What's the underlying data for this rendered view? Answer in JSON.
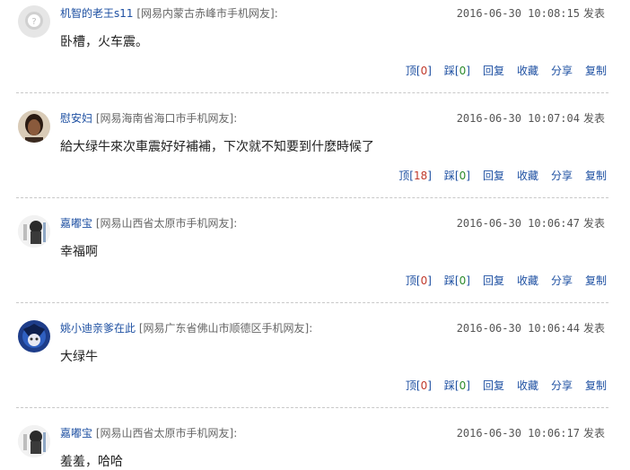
{
  "actions": {
    "up": "顶",
    "down": "踩",
    "reply": "回复",
    "favorite": "收藏",
    "share": "分享",
    "copy": "复制",
    "publish": "发表"
  },
  "comments": [
    {
      "username": "机智的老王s11",
      "location": "[网易内蒙古赤峰市手机网友]:",
      "time": "2016-06-30 10:08:15",
      "content": "卧槽，火车震。",
      "up": "0",
      "down": "0",
      "avatar": "default-avatar-icon"
    },
    {
      "username": "慰安妇",
      "location": "[网易海南省海口市手机网友]:",
      "time": "2016-06-30 10:07:04",
      "content": "給大绿牛來次車震好好補補，下次就不知要到什麽時候了",
      "up": "18",
      "down": "0",
      "avatar": "photo-avatar"
    },
    {
      "username": "嘉嘟宝",
      "location": "[网易山西省太原市手机网友]:",
      "time": "2016-06-30 10:06:47",
      "content": "幸福啊",
      "up": "0",
      "down": "0",
      "avatar": "illustrated-avatar"
    },
    {
      "username": "姚小迪亲爹在此",
      "location": "[网易广东省佛山市顺德区手机网友]:",
      "time": "2016-06-30 10:06:44",
      "content": "大绿牛",
      "up": "0",
      "down": "0",
      "avatar": "anime-avatar"
    },
    {
      "username": "嘉嘟宝",
      "location": "[网易山西省太原市手机网友]:",
      "time": "2016-06-30 10:06:17",
      "content": "羞羞，哈哈",
      "up": "0",
      "down": "0",
      "avatar": "illustrated-avatar"
    }
  ]
}
